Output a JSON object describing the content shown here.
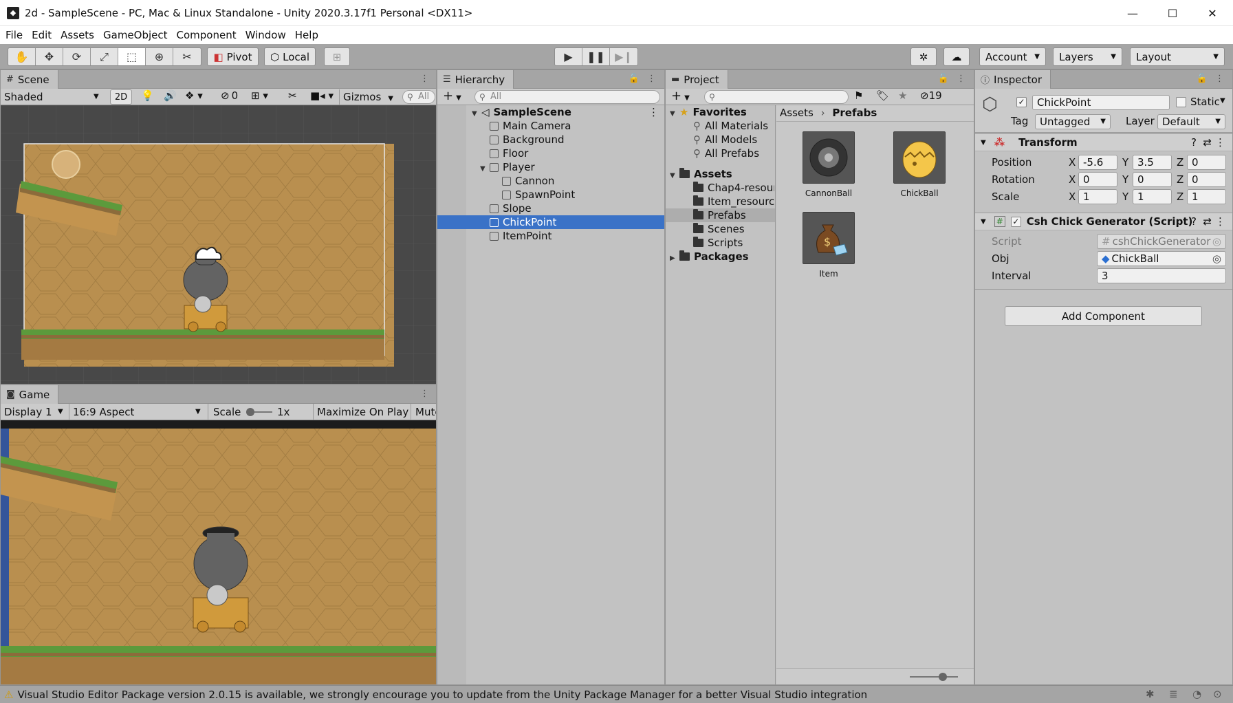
{
  "window": {
    "title": "2d - SampleScene - PC, Mac & Linux Standalone - Unity 2020.3.17f1 Personal <DX11>",
    "minimize_glyph": "—",
    "maximize_glyph": "☐",
    "close_glyph": "✕"
  },
  "menu": [
    "File",
    "Edit",
    "Assets",
    "GameObject",
    "Component",
    "Window",
    "Help"
  ],
  "toolbar": {
    "pivot_label": "Pivot",
    "local_label": "Local",
    "account_label": "Account",
    "layers_label": "Layers",
    "layout_label": "Layout"
  },
  "scene": {
    "tab_label": "Scene",
    "shading_mode": "Shaded",
    "mode_2d": "2D",
    "hidden_count": "0",
    "gizmos_label": "Gizmos",
    "search_placeholder": "All"
  },
  "game": {
    "tab_label": "Game",
    "display": "Display 1",
    "aspect": "16:9 Aspect",
    "scale_label": "Scale",
    "scale_value": "1x",
    "maximize_label": "Maximize On Play",
    "mute_label": "Mute"
  },
  "hierarchy": {
    "tab_label": "Hierarchy",
    "search_placeholder": "All",
    "scene_name": "SampleScene",
    "items": [
      "Main Camera",
      "Background",
      "Floor",
      "Player",
      "Cannon",
      "SpawnPoint",
      "Slope",
      "ChickPoint",
      "ItemPoint"
    ]
  },
  "project": {
    "tab_label": "Project",
    "hidden_count": "19",
    "favorites_label": "Favorites",
    "favorites": [
      "All Materials",
      "All Models",
      "All Prefabs"
    ],
    "assets_label": "Assets",
    "folders": [
      "Chap4-resour",
      "Item_resource",
      "Prefabs",
      "Scenes",
      "Scripts"
    ],
    "packages_label": "Packages",
    "breadcrumb_root": "Assets",
    "breadcrumb_current": "Prefabs",
    "prefabs": [
      "CannonBall",
      "ChickBall",
      "Item"
    ]
  },
  "inspector": {
    "tab_label": "Inspector",
    "object_name": "ChickPoint",
    "static_label": "Static",
    "tag_label": "Tag",
    "tag_value": "Untagged",
    "layer_label": "Layer",
    "layer_value": "Default",
    "transform": {
      "title": "Transform",
      "position_label": "Position",
      "rotation_label": "Rotation",
      "scale_label": "Scale",
      "position": [
        "-5.6",
        "3.5",
        "0"
      ],
      "rotation": [
        "0",
        "0",
        "0"
      ],
      "scale": [
        "1",
        "1",
        "1"
      ],
      "axes": [
        "X",
        "Y",
        "Z"
      ]
    },
    "script_component": {
      "title": "Csh Chick Generator (Script)",
      "script_label": "Script",
      "script_value": "cshChickGenerator",
      "obj_label": "Obj",
      "obj_value": "ChickBall",
      "interval_label": "Interval",
      "interval_value": "3"
    },
    "add_component_label": "Add Component"
  },
  "status": {
    "message": "Visual Studio Editor Package version 2.0.15 is available, we strongly encourage you to update from the Unity Package Manager for a better Visual Studio integration"
  },
  "colors": {
    "selection": "#3a72c7",
    "scene_bg": "#484848",
    "sand": "#b98f4f",
    "grass": "#5c9a3c"
  }
}
